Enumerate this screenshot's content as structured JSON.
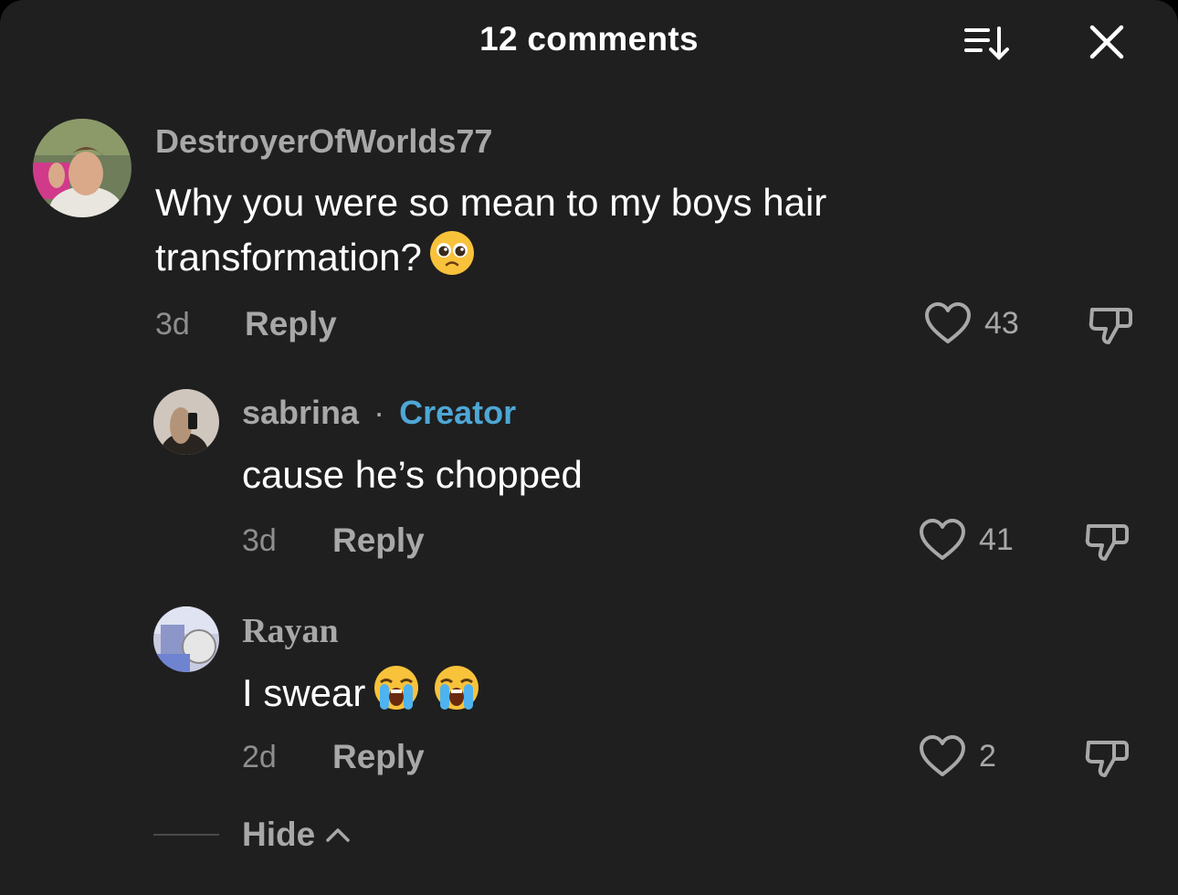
{
  "header": {
    "title": "12 comments",
    "sort_icon": "sort-icon",
    "close_icon": "close-icon"
  },
  "comments": [
    {
      "username": "DestroyerOfWorlds77",
      "text_line1": "Why you were so mean to my boys hair",
      "text_line2": "transformation?",
      "emoji": "pleading-face-emoji",
      "time": "3d",
      "reply_label": "Reply",
      "likes": "43"
    },
    {
      "username": "sabrina",
      "separator": "·",
      "badge": "Creator",
      "text": "cause he’s chopped",
      "time": "3d",
      "reply_label": "Reply",
      "likes": "41"
    },
    {
      "username": "Rayan",
      "text": "I swear",
      "emoji": "loudly-crying-face-emoji",
      "time": "2d",
      "reply_label": "Reply",
      "likes": "2"
    }
  ],
  "footer": {
    "hide_label": "Hide",
    "chevron_icon": "chevron-up-icon"
  },
  "colors": {
    "background": "#1f1f1f",
    "creator_accent": "#4ea7d6",
    "secondary_text": "#a8a8a8"
  }
}
